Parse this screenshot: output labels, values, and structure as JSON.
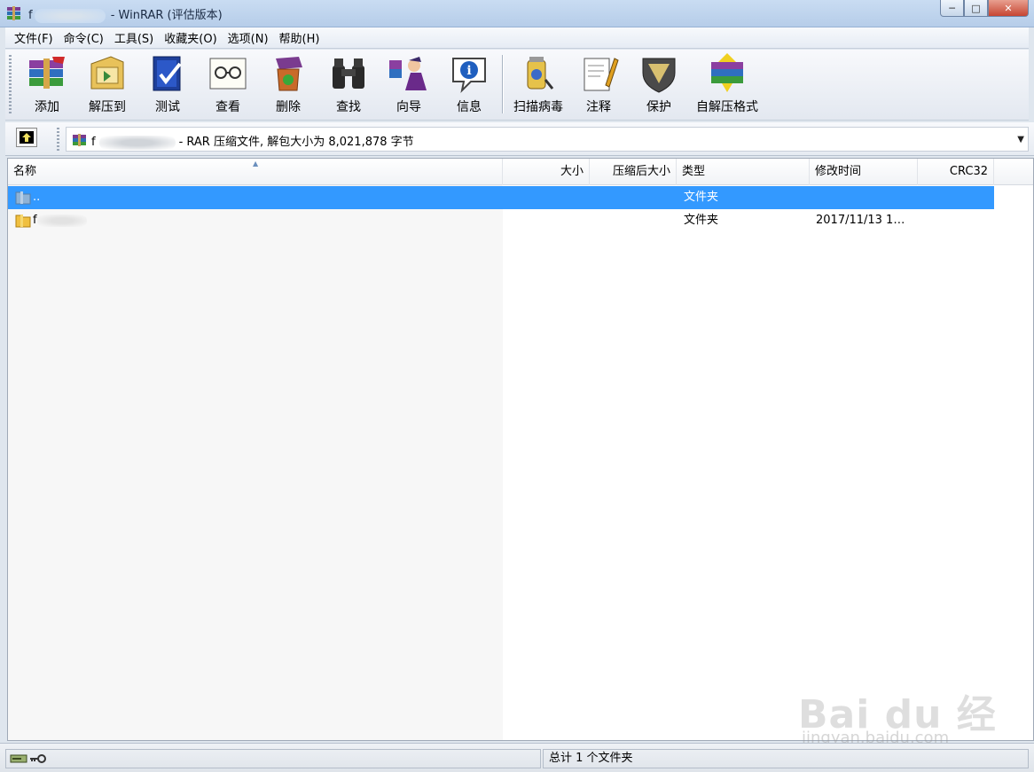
{
  "window": {
    "title_prefix": "f",
    "title_suffix": " - WinRAR (评估版本)",
    "buttons": {
      "minimize": "─",
      "maximize": "□",
      "close": "✕"
    }
  },
  "menu": [
    "文件(F)",
    "命令(C)",
    "工具(S)",
    "收藏夹(O)",
    "选项(N)",
    "帮助(H)"
  ],
  "toolbar": {
    "add": "添加",
    "extract_to": "解压到",
    "test": "测试",
    "view": "查看",
    "delete": "删除",
    "find": "查找",
    "wizard": "向导",
    "info": "信息",
    "scan": "扫描病毒",
    "comment": "注释",
    "protect": "保护",
    "sfx": "自解压格式"
  },
  "address": {
    "prefix": "f",
    "suffix": "- RAR 压缩文件, 解包大小为 8,021,878 字节"
  },
  "columns": {
    "name": "名称",
    "size": "大小",
    "packed": "压缩后大小",
    "type": "类型",
    "modified": "修改时间",
    "crc": "CRC32"
  },
  "rows": [
    {
      "name": "..",
      "type": "文件夹",
      "modified": "",
      "selected": true
    },
    {
      "name": "f",
      "type": "文件夹",
      "modified": "2017/11/13 1…",
      "selected": false
    }
  ],
  "status": {
    "summary": "总计 1 个文件夹"
  },
  "watermark": {
    "brand": "Bai du 经验",
    "url": "jingyan.baidu.com"
  },
  "colors": {
    "selection": "#3399ff",
    "title_bar": "#c9dcf2",
    "close_button": "#c64532"
  }
}
